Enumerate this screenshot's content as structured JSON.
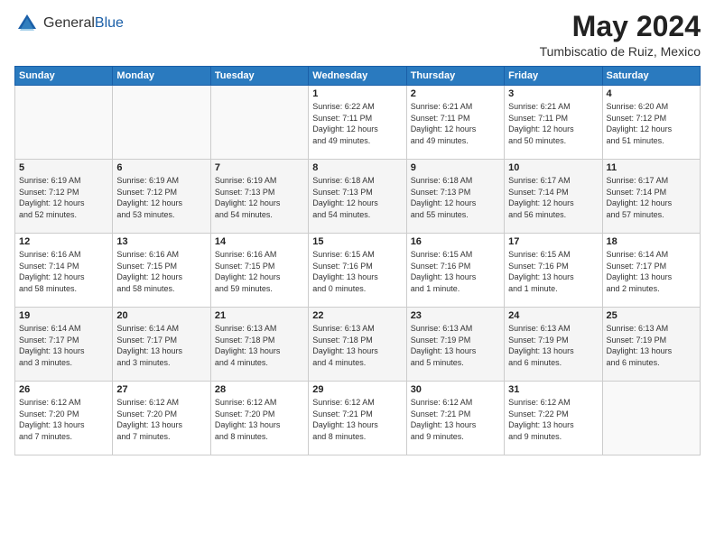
{
  "logo": {
    "general": "General",
    "blue": "Blue"
  },
  "title": "May 2024",
  "location": "Tumbiscatio de Ruiz, Mexico",
  "days_of_week": [
    "Sunday",
    "Monday",
    "Tuesday",
    "Wednesday",
    "Thursday",
    "Friday",
    "Saturday"
  ],
  "weeks": [
    [
      {
        "day": "",
        "info": ""
      },
      {
        "day": "",
        "info": ""
      },
      {
        "day": "",
        "info": ""
      },
      {
        "day": "1",
        "info": "Sunrise: 6:22 AM\nSunset: 7:11 PM\nDaylight: 12 hours\nand 49 minutes."
      },
      {
        "day": "2",
        "info": "Sunrise: 6:21 AM\nSunset: 7:11 PM\nDaylight: 12 hours\nand 49 minutes."
      },
      {
        "day": "3",
        "info": "Sunrise: 6:21 AM\nSunset: 7:11 PM\nDaylight: 12 hours\nand 50 minutes."
      },
      {
        "day": "4",
        "info": "Sunrise: 6:20 AM\nSunset: 7:12 PM\nDaylight: 12 hours\nand 51 minutes."
      }
    ],
    [
      {
        "day": "5",
        "info": "Sunrise: 6:19 AM\nSunset: 7:12 PM\nDaylight: 12 hours\nand 52 minutes."
      },
      {
        "day": "6",
        "info": "Sunrise: 6:19 AM\nSunset: 7:12 PM\nDaylight: 12 hours\nand 53 minutes."
      },
      {
        "day": "7",
        "info": "Sunrise: 6:19 AM\nSunset: 7:13 PM\nDaylight: 12 hours\nand 54 minutes."
      },
      {
        "day": "8",
        "info": "Sunrise: 6:18 AM\nSunset: 7:13 PM\nDaylight: 12 hours\nand 54 minutes."
      },
      {
        "day": "9",
        "info": "Sunrise: 6:18 AM\nSunset: 7:13 PM\nDaylight: 12 hours\nand 55 minutes."
      },
      {
        "day": "10",
        "info": "Sunrise: 6:17 AM\nSunset: 7:14 PM\nDaylight: 12 hours\nand 56 minutes."
      },
      {
        "day": "11",
        "info": "Sunrise: 6:17 AM\nSunset: 7:14 PM\nDaylight: 12 hours\nand 57 minutes."
      }
    ],
    [
      {
        "day": "12",
        "info": "Sunrise: 6:16 AM\nSunset: 7:14 PM\nDaylight: 12 hours\nand 58 minutes."
      },
      {
        "day": "13",
        "info": "Sunrise: 6:16 AM\nSunset: 7:15 PM\nDaylight: 12 hours\nand 58 minutes."
      },
      {
        "day": "14",
        "info": "Sunrise: 6:16 AM\nSunset: 7:15 PM\nDaylight: 12 hours\nand 59 minutes."
      },
      {
        "day": "15",
        "info": "Sunrise: 6:15 AM\nSunset: 7:16 PM\nDaylight: 13 hours\nand 0 minutes."
      },
      {
        "day": "16",
        "info": "Sunrise: 6:15 AM\nSunset: 7:16 PM\nDaylight: 13 hours\nand 1 minute."
      },
      {
        "day": "17",
        "info": "Sunrise: 6:15 AM\nSunset: 7:16 PM\nDaylight: 13 hours\nand 1 minute."
      },
      {
        "day": "18",
        "info": "Sunrise: 6:14 AM\nSunset: 7:17 PM\nDaylight: 13 hours\nand 2 minutes."
      }
    ],
    [
      {
        "day": "19",
        "info": "Sunrise: 6:14 AM\nSunset: 7:17 PM\nDaylight: 13 hours\nand 3 minutes."
      },
      {
        "day": "20",
        "info": "Sunrise: 6:14 AM\nSunset: 7:17 PM\nDaylight: 13 hours\nand 3 minutes."
      },
      {
        "day": "21",
        "info": "Sunrise: 6:13 AM\nSunset: 7:18 PM\nDaylight: 13 hours\nand 4 minutes."
      },
      {
        "day": "22",
        "info": "Sunrise: 6:13 AM\nSunset: 7:18 PM\nDaylight: 13 hours\nand 4 minutes."
      },
      {
        "day": "23",
        "info": "Sunrise: 6:13 AM\nSunset: 7:19 PM\nDaylight: 13 hours\nand 5 minutes."
      },
      {
        "day": "24",
        "info": "Sunrise: 6:13 AM\nSunset: 7:19 PM\nDaylight: 13 hours\nand 6 minutes."
      },
      {
        "day": "25",
        "info": "Sunrise: 6:13 AM\nSunset: 7:19 PM\nDaylight: 13 hours\nand 6 minutes."
      }
    ],
    [
      {
        "day": "26",
        "info": "Sunrise: 6:12 AM\nSunset: 7:20 PM\nDaylight: 13 hours\nand 7 minutes."
      },
      {
        "day": "27",
        "info": "Sunrise: 6:12 AM\nSunset: 7:20 PM\nDaylight: 13 hours\nand 7 minutes."
      },
      {
        "day": "28",
        "info": "Sunrise: 6:12 AM\nSunset: 7:20 PM\nDaylight: 13 hours\nand 8 minutes."
      },
      {
        "day": "29",
        "info": "Sunrise: 6:12 AM\nSunset: 7:21 PM\nDaylight: 13 hours\nand 8 minutes."
      },
      {
        "day": "30",
        "info": "Sunrise: 6:12 AM\nSunset: 7:21 PM\nDaylight: 13 hours\nand 9 minutes."
      },
      {
        "day": "31",
        "info": "Sunrise: 6:12 AM\nSunset: 7:22 PM\nDaylight: 13 hours\nand 9 minutes."
      },
      {
        "day": "",
        "info": ""
      }
    ]
  ]
}
